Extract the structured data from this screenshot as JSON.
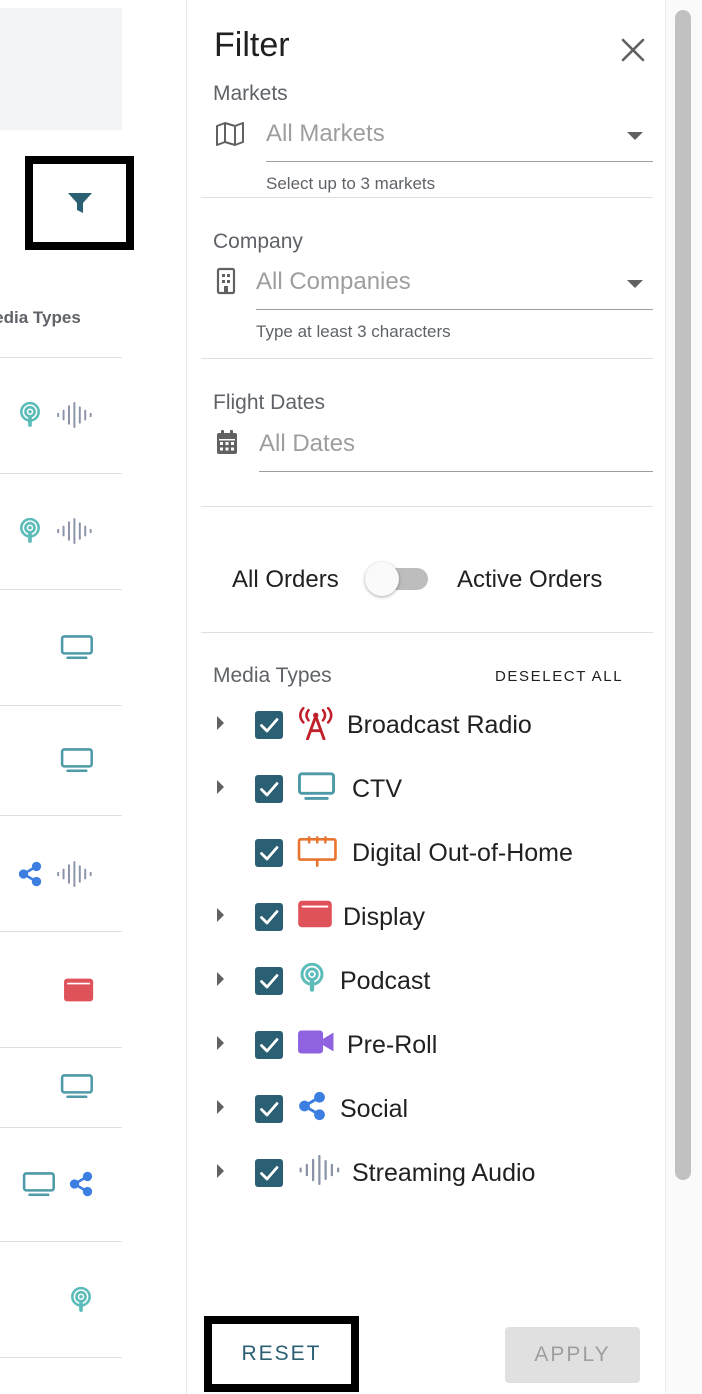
{
  "background_table": {
    "column_header": "Media Types",
    "rows": [
      {
        "icons": [
          "podcast-icon",
          "streaming-audio-icon"
        ]
      },
      {
        "icons": [
          "podcast-icon",
          "streaming-audio-icon"
        ]
      },
      {
        "icons": [
          "ctv-icon"
        ]
      },
      {
        "icons": [
          "ctv-icon"
        ]
      },
      {
        "icons": [
          "social-icon",
          "streaming-audio-icon"
        ]
      },
      {
        "icons": [
          "display-icon"
        ]
      },
      {
        "icons": [
          "ctv-icon"
        ]
      },
      {
        "icons": [
          "ctv-icon",
          "social-icon"
        ]
      },
      {
        "icons": [
          "podcast-icon"
        ]
      }
    ]
  },
  "filter": {
    "title": "Filter",
    "markets": {
      "label": "Markets",
      "value": "All Markets",
      "hint": "Select up to 3 markets"
    },
    "company": {
      "label": "Company",
      "value": "All Companies",
      "hint": "Type at least 3 characters"
    },
    "flight_dates": {
      "label": "Flight Dates",
      "value": "All Dates"
    },
    "orders_toggle": {
      "left_label": "All Orders",
      "right_label": "Active Orders",
      "active_only": false
    },
    "media_types": {
      "label": "Media Types",
      "deselect_label": "DESELECT ALL",
      "items": [
        {
          "label": "Broadcast Radio",
          "checked": true,
          "expandable": true,
          "icon": "broadcast-radio-icon"
        },
        {
          "label": "CTV",
          "checked": true,
          "expandable": true,
          "icon": "ctv-icon"
        },
        {
          "label": "Digital Out-of-Home",
          "checked": true,
          "expandable": false,
          "icon": "billboard-icon"
        },
        {
          "label": "Display",
          "checked": true,
          "expandable": true,
          "icon": "display-icon"
        },
        {
          "label": "Podcast",
          "checked": true,
          "expandable": true,
          "icon": "podcast-icon"
        },
        {
          "label": "Pre-Roll",
          "checked": true,
          "expandable": true,
          "icon": "video-camera-icon"
        },
        {
          "label": "Social",
          "checked": true,
          "expandable": true,
          "icon": "social-icon"
        },
        {
          "label": "Streaming Audio",
          "checked": true,
          "expandable": true,
          "icon": "streaming-audio-icon"
        }
      ]
    },
    "reset_label": "RESET",
    "apply_label": "APPLY"
  },
  "colors": {
    "teal": "#2b5f74",
    "podcast": "#5cbcb9",
    "ctv": "#4f9aa8",
    "display": "#e0525a",
    "social": "#3d7fe0",
    "broadcast": "#c0202a",
    "billboard": "#e8752f",
    "video": "#8f63e0",
    "audio": "#8a93a8"
  }
}
